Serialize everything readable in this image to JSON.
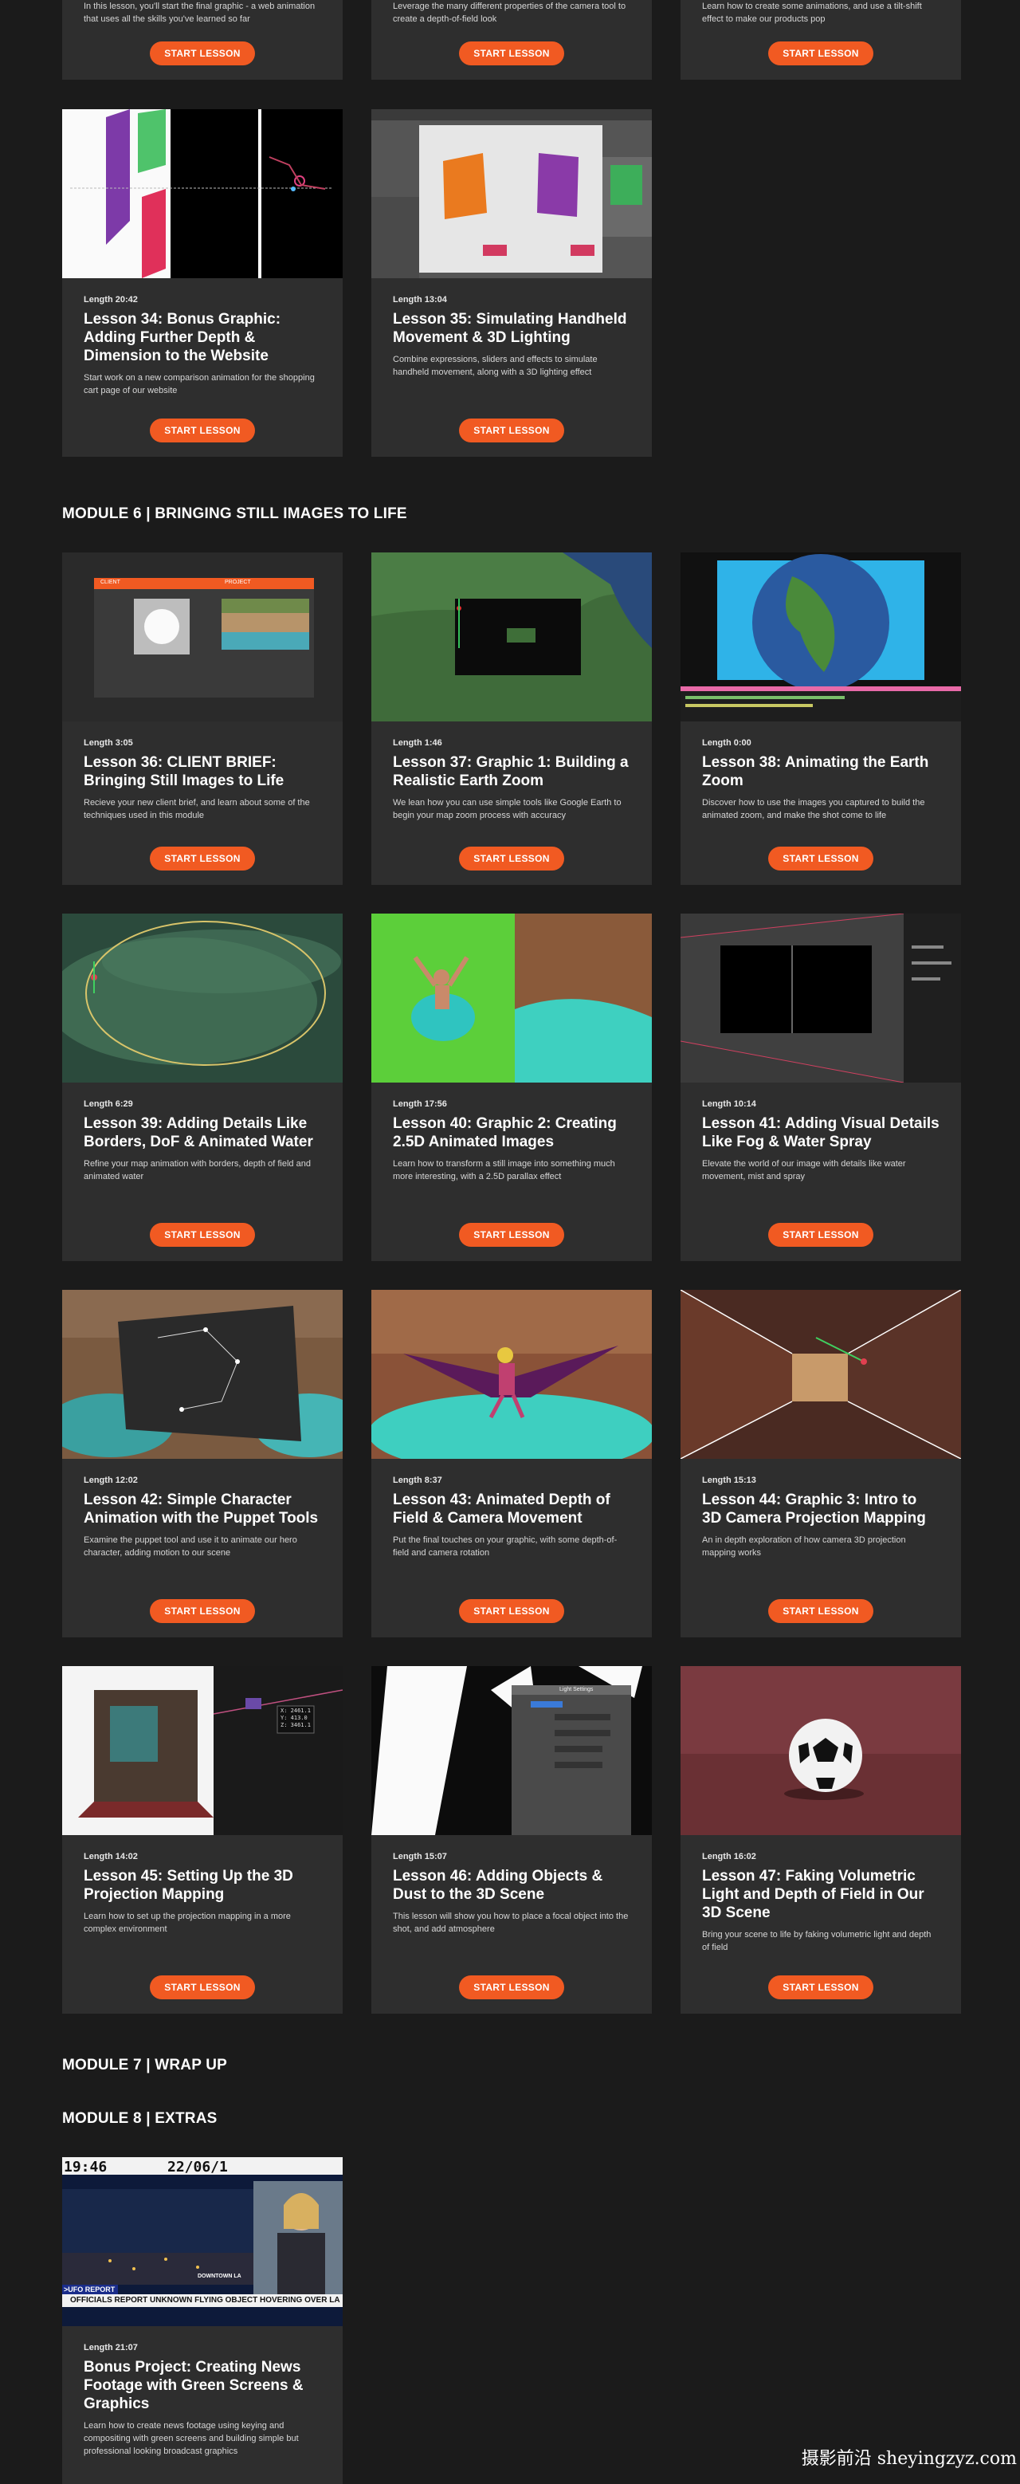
{
  "button_label": "START LESSON",
  "top_row": [
    {
      "desc": "In this lesson, you'll start the final graphic - a web animation that uses all the skills you've learned so far"
    },
    {
      "desc": "Leverage the many different properties of the camera tool to create a depth-of-field look"
    },
    {
      "desc": "Learn how to create some animations, and use a tilt-shift effect to make our products pop"
    }
  ],
  "module5_lessons": [
    {
      "length": "Length 20:42",
      "title": "Lesson 34: Bonus Graphic: Adding Further Depth & Dimension to the Website",
      "desc": "Start work on a new comparison animation for the shopping cart page of our website",
      "thumb": "web-animation"
    },
    {
      "length": "Length 13:04",
      "title": "Lesson 35: Simulating Handheld Movement & 3D Lighting",
      "desc": "Combine expressions, sliders and effects to simulate handheld movement, along with a 3D lighting effect",
      "thumb": "product-boxes"
    }
  ],
  "module6": {
    "heading": "MODULE 6 | BRINGING STILL IMAGES TO LIFE",
    "lessons": [
      {
        "length": "Length 3:05",
        "title": "Lesson 36: CLIENT BRIEF: Bringing Still Images to Life",
        "desc": "Recieve your new client brief, and learn about some of the techniques used in this module",
        "thumb": "client-brief",
        "panel_left": "CLIENT",
        "panel_right": "PROJECT"
      },
      {
        "length": "Length 1:46",
        "title": "Lesson 37: Graphic 1: Building a Realistic Earth Zoom",
        "desc": "We lean how you can use simple tools like Google Earth to begin your map zoom process with accuracy",
        "thumb": "earth-map"
      },
      {
        "length": "Length 0:00",
        "title": "Lesson 38: Animating the Earth Zoom",
        "desc": "Discover how to use the images you captured to build the animated zoom, and make the shot come to life",
        "thumb": "globe"
      },
      {
        "length": "Length 6:29",
        "title": "Lesson 39: Adding Details Like Borders, DoF & Animated Water",
        "desc": "Refine your map animation with borders, depth of field and animated water",
        "thumb": "terrain"
      },
      {
        "length": "Length 17:56",
        "title": "Lesson 40: Graphic 2: Creating 2.5D Animated Images",
        "desc": "Learn how to transform a still image into something much more interesting, with a 2.5D parallax effect",
        "thumb": "jumper"
      },
      {
        "length": "Length 10:14",
        "title": "Lesson 41: Adding Visual Details Like Fog & Water Spray",
        "desc": "Elevate the world of our image with details like water movement, mist and spray",
        "thumb": "dark-comp"
      },
      {
        "length": "Length 12:02",
        "title": "Lesson 42: Simple Character Animation with the Puppet Tools",
        "desc": "Examine the puppet tool and use it to animate our hero character, adding motion to our scene",
        "thumb": "puppet"
      },
      {
        "length": "Length 8:37",
        "title": "Lesson 43: Animated Depth of Field & Camera Movement",
        "desc": "Put the final touches on your graphic, with some depth-of-field and camera rotation",
        "thumb": "bird-man"
      },
      {
        "length": "Length 15:13",
        "title": "Lesson 44: Graphic 3: Intro to 3D Camera Projection Mapping",
        "desc": "An in depth exploration of how camera 3D projection mapping works",
        "thumb": "alley"
      },
      {
        "length": "Length 14:02",
        "title": "Lesson 45: Setting Up the 3D Projection Mapping",
        "desc": "Learn how to set up the projection mapping in a more complex environment",
        "thumb": "room",
        "readout": [
          "X: 2461.1",
          "Y: 413.0",
          "Z: 3461.1"
        ]
      },
      {
        "length": "Length 15:07",
        "title": "Lesson 46: Adding Objects & Dust to the 3D Scene",
        "desc": "This lesson will show you how to place a focal object into the shot, and add atmosphere",
        "thumb": "settings-panel",
        "panel_title": "Light Settings"
      },
      {
        "length": "Length 16:02",
        "title": "Lesson 47: Faking Volumetric Light and Depth of Field in Our 3D Scene",
        "desc": "Bring your scene to life by faking volumetric light and depth of field",
        "thumb": "football"
      }
    ]
  },
  "module7": {
    "heading": "MODULE 7 | WRAP UP"
  },
  "module8": {
    "heading": "MODULE 8 | EXTRAS",
    "lessons": [
      {
        "length": "Length 21:07",
        "title": "Bonus Project: Creating News Footage with Green Screens & Graphics",
        "desc": "Learn how to create news footage using keying and compositing with green screens and building simple but professional looking broadcast graphics",
        "thumb": "news",
        "news_time": "19:46",
        "news_date": "22/06/1",
        "news_tag": ">UFO REPORT",
        "news_location": "DOWNTOWN LA",
        "news_ticker": "OFFICIALS REPORT UNKNOWN FLYING OBJECT HOVERING OVER LA"
      }
    ]
  },
  "watermark": "摄影前沿 sheyingzyz.com"
}
